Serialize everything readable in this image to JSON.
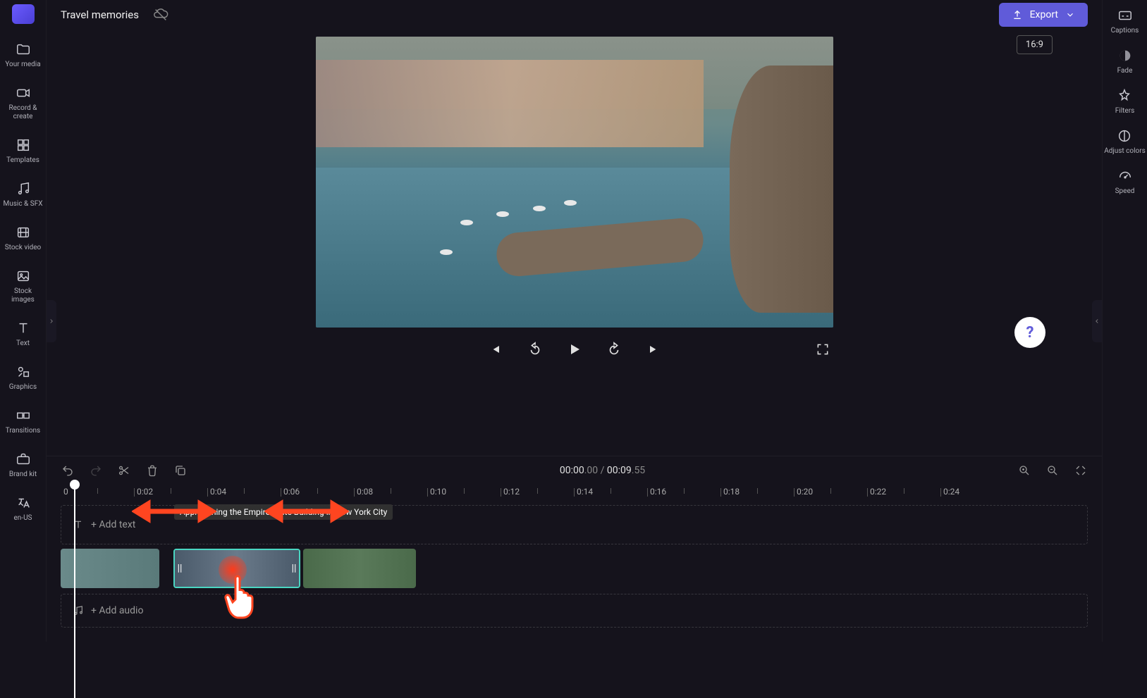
{
  "project": {
    "title": "Travel memories"
  },
  "topbar": {
    "export_label": "Export",
    "aspect_ratio": "16:9"
  },
  "leftSidebar": [
    {
      "id": "your-media",
      "label": "Your media"
    },
    {
      "id": "record-create",
      "label": "Record & create"
    },
    {
      "id": "templates",
      "label": "Templates"
    },
    {
      "id": "music-sfx",
      "label": "Music & SFX"
    },
    {
      "id": "stock-video",
      "label": "Stock video"
    },
    {
      "id": "stock-images",
      "label": "Stock images"
    },
    {
      "id": "text",
      "label": "Text"
    },
    {
      "id": "graphics",
      "label": "Graphics"
    },
    {
      "id": "transitions",
      "label": "Transitions"
    },
    {
      "id": "brand-kit",
      "label": "Brand kit"
    },
    {
      "id": "language",
      "label": "en-US"
    }
  ],
  "rightSidebar": [
    {
      "id": "captions",
      "label": "Captions"
    },
    {
      "id": "fade",
      "label": "Fade"
    },
    {
      "id": "filters",
      "label": "Filters"
    },
    {
      "id": "adjust-colors",
      "label": "Adjust colors"
    },
    {
      "id": "speed",
      "label": "Speed"
    }
  ],
  "playback": {
    "current": "00:00",
    "current_ms": ".00",
    "separator": " / ",
    "total": "00:09",
    "total_ms": ".55"
  },
  "timeline": {
    "zero": "0",
    "ticks": [
      "0:02",
      "0:04",
      "0:06",
      "0:08",
      "0:10",
      "0:12",
      "0:14",
      "0:16",
      "0:18",
      "0:20",
      "0:22",
      "0:24"
    ],
    "add_text": "+ Add text",
    "add_audio": "+ Add audio",
    "tooltip": "Approaching the Empire State Building in New York City"
  }
}
